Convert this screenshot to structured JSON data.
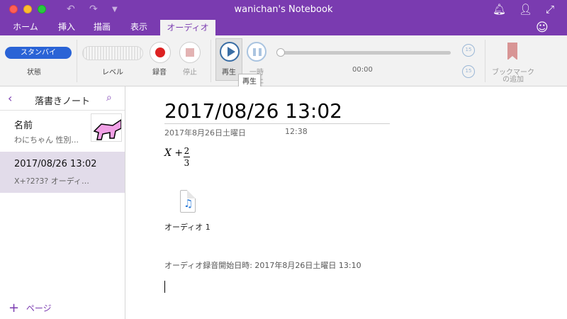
{
  "window": {
    "title": "wanichan's Notebook"
  },
  "tabs": [
    {
      "label": "ホーム"
    },
    {
      "label": "挿入"
    },
    {
      "label": "描画"
    },
    {
      "label": "表示"
    },
    {
      "label": "オーディオ",
      "active": true
    }
  ],
  "ribbon": {
    "status_pill": "スタンバイ",
    "status_label": "状態",
    "level_label": "レベル",
    "record_label": "録音",
    "stop_label": "停止",
    "play_label": "再生",
    "pause_label": "一時",
    "pause_label2": "停止",
    "time": "00:00",
    "skip_back": "15",
    "skip_forward": "15",
    "bookmark_label1": "ブックマーク",
    "bookmark_label2": "の追加",
    "tooltip": "再生"
  },
  "sidebar": {
    "title": "落書きノート",
    "pages": [
      {
        "title": "名前",
        "subtitle": "わにちゃん 性別...",
        "selected": false
      },
      {
        "title": "2017/08/26 13:02",
        "subtitle": "X+?2?3? オーディ…",
        "selected": true
      }
    ],
    "add_page": "ページ"
  },
  "note": {
    "title": "2017/08/26 13:02",
    "date": "2017年8月26日土曜日",
    "time": "12:38",
    "formula_var": "X +",
    "formula_num": "2",
    "formula_den": "3",
    "audio_label": "オーディオ 1",
    "audio_started": "オーディオ録音開始日時: 2017年8月26日土曜日 13:10"
  },
  "colors": {
    "brand": "#7a3bb0",
    "status_pill": "#2a63d6",
    "record": "#dd2222",
    "play": "#3a6ea5",
    "selected_page": "#e2dcea"
  }
}
